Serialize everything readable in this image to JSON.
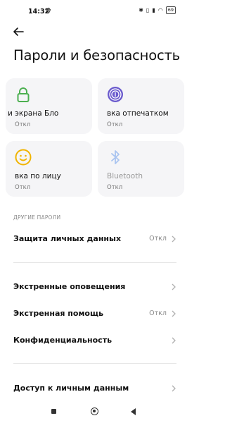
{
  "status_bar": {
    "time": "14:32",
    "battery": "69"
  },
  "header": {
    "title": "Пароли и безопасность"
  },
  "tiles": [
    {
      "label": "и экрана        Бло",
      "status": "Откл",
      "icon": "lock-icon",
      "color": "#4caf50"
    },
    {
      "label": "вка отпечатком",
      "status": "Откл",
      "icon": "fingerprint-icon",
      "color": "#6a5acd"
    },
    {
      "label": "вка по лицу",
      "status": "Откл",
      "icon": "face-icon",
      "color": "#f0b400"
    },
    {
      "label": "Bluetooth",
      "status": "Откл",
      "icon": "bluetooth-icon",
      "color": "#a9c4f0"
    }
  ],
  "section": {
    "header": "ДРУГИЕ ПАРОЛИ"
  },
  "rows": [
    {
      "label": "Защита личных данных",
      "value": "Откл"
    },
    {
      "label": "Экстренные оповещения",
      "value": ""
    },
    {
      "label": "Экстренная помощь",
      "value": "Откл"
    },
    {
      "label": "Конфиденциальность",
      "value": ""
    },
    {
      "label": "Доступ к личным данным",
      "value": ""
    }
  ]
}
